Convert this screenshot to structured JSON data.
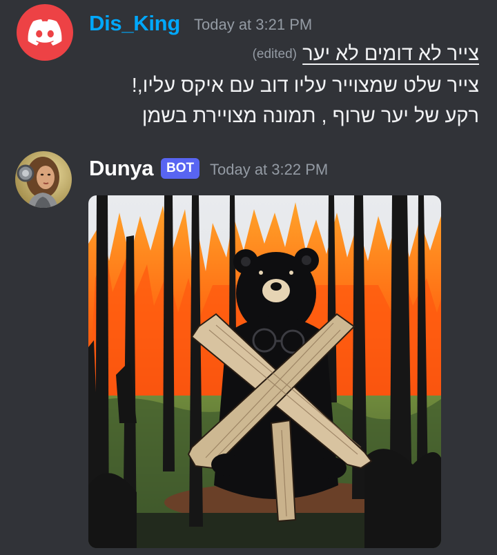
{
  "messages": [
    {
      "author": "Dis_King",
      "timestamp": "Today at 3:21 PM",
      "edited_label": "(edited)",
      "lines": [
        "צייר  לא דומים לא יער",
        "צייר שלט שמצוייר עליו דוב עם איקס עליו,!",
        "רקע של יער שרוף , תמונה מצויירת בשמן"
      ],
      "avatar_icon": "discord-logo-icon"
    },
    {
      "author": "Dunya",
      "badge": "BOT",
      "timestamp": "Today at 3:22 PM",
      "avatar_icon": "woman-portrait-avatar",
      "attachment": {
        "description_icon": "bear-with-x-burning-forest-painting"
      }
    }
  ],
  "colors": {
    "background": "#313338",
    "username_blue": "#00a8fc",
    "bot_badge": "#5865f2",
    "discord_red": "#ed4245",
    "timestamp_gray": "#949ba4"
  }
}
